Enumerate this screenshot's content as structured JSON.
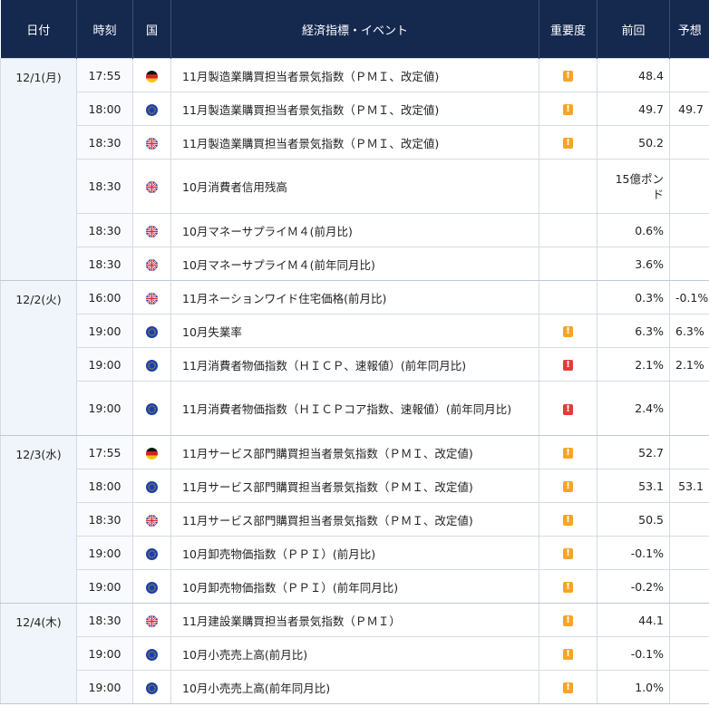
{
  "headers": [
    "日付",
    "時刻",
    "国",
    "経済指標・イベント",
    "重要度",
    "前回",
    "予想"
  ],
  "colors": {
    "header_bg": "#15294f",
    "medium": "#f7a427",
    "high": "#e63b3b"
  },
  "rows": [
    {
      "date": "12/1(月)",
      "rowspan": 6,
      "time": "17:55",
      "country": "de-flag-icon",
      "event": "11月製造業購買担当者景気指数（ＰＭＩ、改定値)",
      "importance": "medium",
      "prev": "48.4",
      "forecast": ""
    },
    {
      "time": "18:00",
      "country": "eu-flag-icon",
      "event": "11月製造業購買担当者景気指数（ＰＭＩ、改定値)",
      "importance": "medium",
      "prev": "49.7",
      "forecast": "49.7"
    },
    {
      "time": "18:30",
      "country": "uk-flag-icon",
      "event": "11月製造業購買担当者景気指数（ＰＭＩ、改定値)",
      "importance": "medium",
      "prev": "50.2",
      "forecast": ""
    },
    {
      "time": "18:30",
      "country": "uk-flag-icon",
      "event": "10月消費者信用残高",
      "importance": "",
      "prev": "15億ポンド",
      "forecast": "",
      "tall": true
    },
    {
      "time": "18:30",
      "country": "uk-flag-icon",
      "event": "10月マネーサプライＭ４(前月比)",
      "importance": "",
      "prev": "0.6%",
      "forecast": ""
    },
    {
      "time": "18:30",
      "country": "uk-flag-icon",
      "event": "10月マネーサプライＭ４(前年同月比)",
      "importance": "",
      "prev": "3.6%",
      "forecast": ""
    },
    {
      "date": "12/2(火)",
      "rowspan": 4,
      "time": "16:00",
      "country": "uk-flag-icon",
      "event": "11月ネーションワイド住宅価格(前月比)",
      "importance": "",
      "prev": "0.3%",
      "forecast": "-0.1%"
    },
    {
      "time": "19:00",
      "country": "eu-flag-icon",
      "event": "10月失業率",
      "importance": "medium",
      "prev": "6.3%",
      "forecast": "6.3%"
    },
    {
      "time": "19:00",
      "country": "eu-flag-icon",
      "event": "11月消費者物価指数（ＨＩＣＰ、速報値）(前年同月比)",
      "importance": "high",
      "prev": "2.1%",
      "forecast": "2.1%"
    },
    {
      "time": "19:00",
      "country": "eu-flag-icon",
      "event": "11月消費者物価指数（ＨＩＣＰコア指数、速報値）(前年同月比)",
      "importance": "high",
      "prev": "2.4%",
      "forecast": "",
      "tall": true
    },
    {
      "date": "12/3(水)",
      "rowspan": 5,
      "time": "17:55",
      "country": "de-flag-icon",
      "event": "11月サービス部門購買担当者景気指数（ＰＭＩ、改定値)",
      "importance": "medium",
      "prev": "52.7",
      "forecast": ""
    },
    {
      "time": "18:00",
      "country": "eu-flag-icon",
      "event": "11月サービス部門購買担当者景気指数（ＰＭＩ、改定値)",
      "importance": "medium",
      "prev": "53.1",
      "forecast": "53.1"
    },
    {
      "time": "18:30",
      "country": "uk-flag-icon",
      "event": "11月サービス部門購買担当者景気指数（ＰＭＩ、改定値)",
      "importance": "medium",
      "prev": "50.5",
      "forecast": ""
    },
    {
      "time": "19:00",
      "country": "eu-flag-icon",
      "event": "10月卸売物価指数（ＰＰＩ）(前月比)",
      "importance": "medium",
      "prev": "-0.1%",
      "forecast": ""
    },
    {
      "time": "19:00",
      "country": "eu-flag-icon",
      "event": "10月卸売物価指数（ＰＰＩ）(前年同月比)",
      "importance": "medium",
      "prev": "-0.2%",
      "forecast": ""
    },
    {
      "date": "12/4(木)",
      "rowspan": 3,
      "time": "18:30",
      "country": "uk-flag-icon",
      "event": "11月建設業購買担当者景気指数（ＰＭＩ）",
      "importance": "medium",
      "prev": "44.1",
      "forecast": ""
    },
    {
      "time": "19:00",
      "country": "eu-flag-icon",
      "event": "10月小売売上高(前月比)",
      "importance": "medium",
      "prev": "-0.1%",
      "forecast": ""
    },
    {
      "time": "19:00",
      "country": "eu-flag-icon",
      "event": "10月小売売上高(前年同月比)",
      "importance": "medium",
      "prev": "1.0%",
      "forecast": ""
    }
  ]
}
